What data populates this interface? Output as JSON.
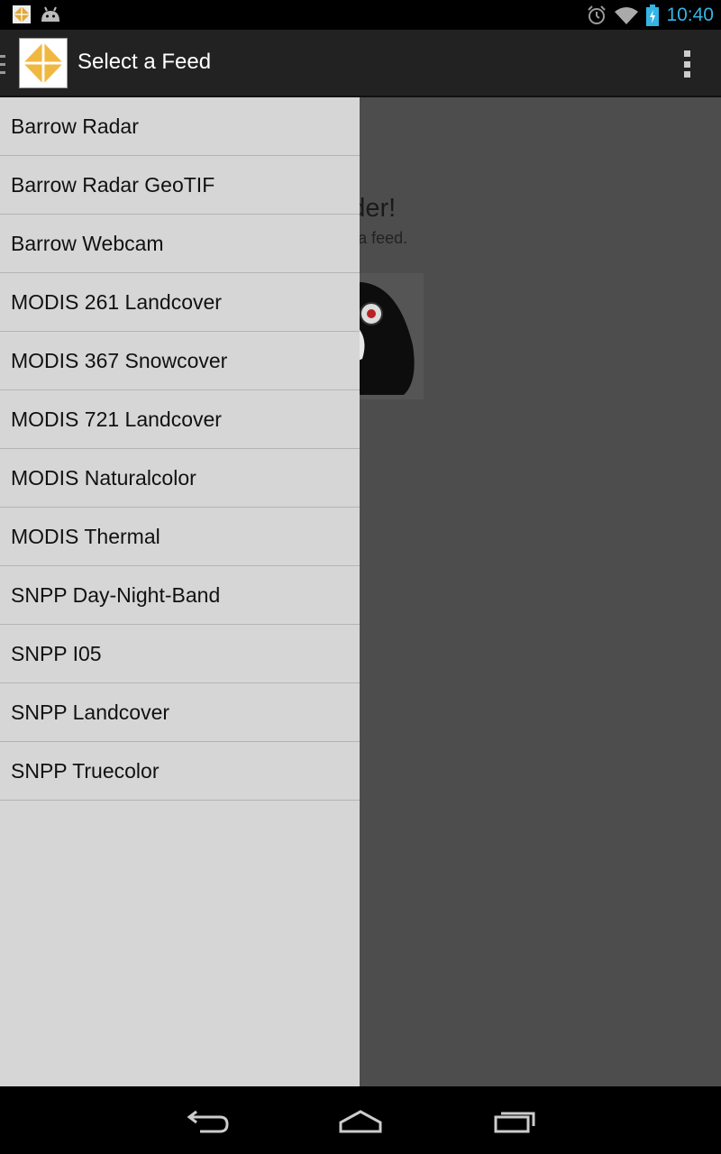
{
  "status_bar": {
    "time": "10:40",
    "icons": [
      "app-notification-icon",
      "android-notification-icon",
      "alarm-icon",
      "wifi-icon",
      "battery-charging-icon"
    ]
  },
  "action_bar": {
    "title": "Select a Feed",
    "logo_icon": "feeder-logo-icon",
    "overflow_icon": "overflow-menu-icon"
  },
  "main": {
    "welcome_title": "to Feeder!",
    "welcome_subtitle": "edge to select a feed.",
    "image": "penguin-image"
  },
  "drawer": {
    "items": [
      "Barrow Radar",
      "Barrow Radar GeoTIF",
      "Barrow Webcam",
      "MODIS 261 Landcover",
      "MODIS 367 Snowcover",
      "MODIS 721 Landcover",
      "MODIS Naturalcolor",
      "MODIS Thermal",
      "SNPP Day-Night-Band",
      "SNPP I05",
      "SNPP Landcover",
      "SNPP Truecolor"
    ]
  },
  "nav_bar": {
    "buttons": [
      "back-icon",
      "home-icon",
      "recent-apps-icon"
    ]
  },
  "colors": {
    "accent_time": "#33b5e5",
    "logo_gold": "#f0b840",
    "drawer_bg": "#d6d6d6",
    "action_bar_bg": "#222222"
  }
}
